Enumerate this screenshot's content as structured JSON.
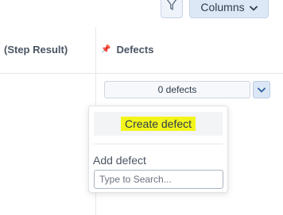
{
  "toolbar": {
    "filter_icon": "filter-icon",
    "columns_label": "Columns",
    "columns_icon": "chevron-down-icon"
  },
  "table": {
    "columns": {
      "step_result": "(Step Result)",
      "defects": "Defects",
      "defects_icon": "pin-icon"
    },
    "row": {
      "defects_value": "0 defects",
      "toggle_icon": "chevron-down-icon"
    }
  },
  "dropdown": {
    "create_label": "Create defect",
    "add_label": "Add defect",
    "search_placeholder": "Type to Search..."
  },
  "colors": {
    "highlight": "#f2f51a",
    "accent_bg": "#dde8f6"
  }
}
